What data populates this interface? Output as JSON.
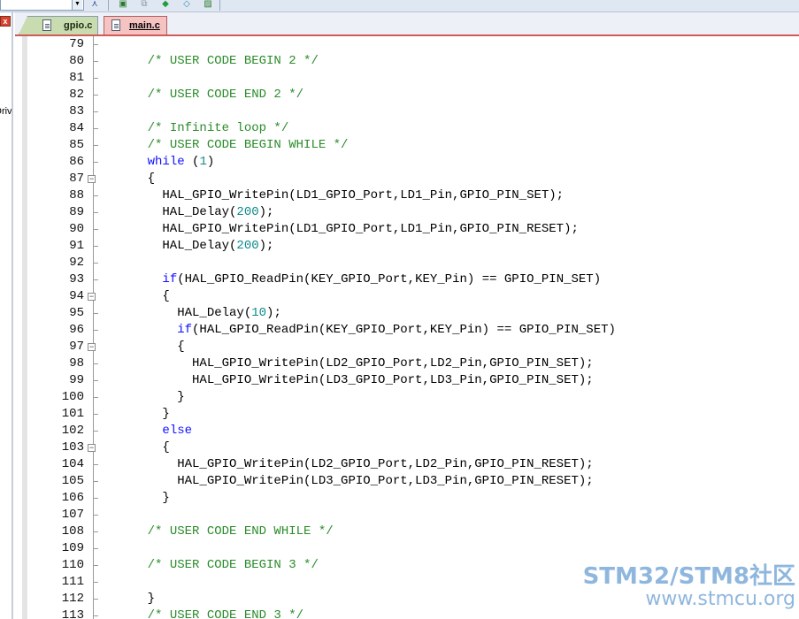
{
  "toolbar": {
    "dropdown_value": "",
    "buttons": [
      "tree-icon",
      "window-icon",
      "copy-icon",
      "green-diamond-icon",
      "brush-icon",
      "image-icon"
    ]
  },
  "project_panel": {
    "close_label": "x",
    "partial_text": "Driv"
  },
  "tabs": [
    {
      "label": "gpio.c",
      "active": false
    },
    {
      "label": "main.c",
      "active": true
    }
  ],
  "editor": {
    "lines": [
      {
        "n": "79",
        "fold": "",
        "parts": []
      },
      {
        "n": "80",
        "fold": "",
        "parts": [
          {
            "t": "    "
          },
          {
            "t": "/* USER CODE BEGIN 2 */",
            "c": "cmt"
          }
        ]
      },
      {
        "n": "81",
        "fold": "",
        "parts": []
      },
      {
        "n": "82",
        "fold": "",
        "parts": [
          {
            "t": "    "
          },
          {
            "t": "/* USER CODE END 2 */",
            "c": "cmt"
          }
        ]
      },
      {
        "n": "83",
        "fold": "",
        "parts": []
      },
      {
        "n": "84",
        "fold": "",
        "parts": [
          {
            "t": "    "
          },
          {
            "t": "/* Infinite loop */",
            "c": "cmt"
          }
        ]
      },
      {
        "n": "85",
        "fold": "",
        "parts": [
          {
            "t": "    "
          },
          {
            "t": "/* USER CODE BEGIN WHILE */",
            "c": "cmt"
          }
        ]
      },
      {
        "n": "86",
        "fold": "",
        "parts": [
          {
            "t": "    "
          },
          {
            "t": "while",
            "c": "kw"
          },
          {
            "t": " ("
          },
          {
            "t": "1",
            "c": "num"
          },
          {
            "t": ")"
          }
        ]
      },
      {
        "n": "87",
        "fold": "minus",
        "parts": [
          {
            "t": "    {"
          }
        ]
      },
      {
        "n": "88",
        "fold": "",
        "parts": [
          {
            "t": "      HAL_GPIO_WritePin(LD1_GPIO_Port,LD1_Pin,GPIO_PIN_SET);"
          }
        ]
      },
      {
        "n": "89",
        "fold": "",
        "parts": [
          {
            "t": "      HAL_Delay("
          },
          {
            "t": "200",
            "c": "num"
          },
          {
            "t": ");"
          }
        ]
      },
      {
        "n": "90",
        "fold": "",
        "parts": [
          {
            "t": "      HAL_GPIO_WritePin(LD1_GPIO_Port,LD1_Pin,GPIO_PIN_RESET);"
          }
        ]
      },
      {
        "n": "91",
        "fold": "",
        "parts": [
          {
            "t": "      HAL_Delay("
          },
          {
            "t": "200",
            "c": "num"
          },
          {
            "t": ");"
          }
        ]
      },
      {
        "n": "92",
        "fold": "",
        "parts": []
      },
      {
        "n": "93",
        "fold": "",
        "parts": [
          {
            "t": "      "
          },
          {
            "t": "if",
            "c": "kw"
          },
          {
            "t": "(HAL_GPIO_ReadPin(KEY_GPIO_Port,KEY_Pin) == GPIO_PIN_SET)"
          }
        ]
      },
      {
        "n": "94",
        "fold": "minus",
        "parts": [
          {
            "t": "      {"
          }
        ]
      },
      {
        "n": "95",
        "fold": "",
        "parts": [
          {
            "t": "        HAL_Delay("
          },
          {
            "t": "10",
            "c": "num"
          },
          {
            "t": ");"
          }
        ]
      },
      {
        "n": "96",
        "fold": "",
        "parts": [
          {
            "t": "        "
          },
          {
            "t": "if",
            "c": "kw"
          },
          {
            "t": "(HAL_GPIO_ReadPin(KEY_GPIO_Port,KEY_Pin) == GPIO_PIN_SET)"
          }
        ]
      },
      {
        "n": "97",
        "fold": "minus",
        "parts": [
          {
            "t": "        {"
          }
        ]
      },
      {
        "n": "98",
        "fold": "",
        "parts": [
          {
            "t": "          HAL_GPIO_WritePin(LD2_GPIO_Port,LD2_Pin,GPIO_PIN_SET);"
          }
        ]
      },
      {
        "n": "99",
        "fold": "",
        "parts": [
          {
            "t": "          HAL_GPIO_WritePin(LD3_GPIO_Port,LD3_Pin,GPIO_PIN_SET);"
          }
        ]
      },
      {
        "n": "100",
        "fold": "",
        "parts": [
          {
            "t": "        }"
          }
        ]
      },
      {
        "n": "101",
        "fold": "",
        "parts": [
          {
            "t": "      }"
          }
        ]
      },
      {
        "n": "102",
        "fold": "",
        "parts": [
          {
            "t": "      "
          },
          {
            "t": "else",
            "c": "kw"
          }
        ]
      },
      {
        "n": "103",
        "fold": "minus",
        "parts": [
          {
            "t": "      {"
          }
        ]
      },
      {
        "n": "104",
        "fold": "",
        "parts": [
          {
            "t": "        HAL_GPIO_WritePin(LD2_GPIO_Port,LD2_Pin,GPIO_PIN_RESET);"
          }
        ]
      },
      {
        "n": "105",
        "fold": "",
        "parts": [
          {
            "t": "        HAL_GPIO_WritePin(LD3_GPIO_Port,LD3_Pin,GPIO_PIN_RESET);"
          }
        ]
      },
      {
        "n": "106",
        "fold": "",
        "parts": [
          {
            "t": "      }"
          }
        ]
      },
      {
        "n": "107",
        "fold": "",
        "parts": []
      },
      {
        "n": "108",
        "fold": "",
        "parts": [
          {
            "t": "    "
          },
          {
            "t": "/* USER CODE END WHILE */",
            "c": "cmt"
          }
        ]
      },
      {
        "n": "109",
        "fold": "",
        "parts": []
      },
      {
        "n": "110",
        "fold": "",
        "parts": [
          {
            "t": "    "
          },
          {
            "t": "/* USER CODE BEGIN 3 */",
            "c": "cmt"
          }
        ]
      },
      {
        "n": "111",
        "fold": "",
        "parts": []
      },
      {
        "n": "112",
        "fold": "",
        "parts": [
          {
            "t": "    }"
          }
        ]
      },
      {
        "n": "113",
        "fold": "",
        "parts": [
          {
            "t": "    "
          },
          {
            "t": "/* USER CODE END 3 */",
            "c": "cmt"
          }
        ]
      }
    ]
  },
  "watermark": {
    "line1": "STM32/STM8社区",
    "line2": "www.stmcu.org"
  },
  "colors": {
    "comment": "#2a8c2a",
    "keyword": "#1010ff",
    "number": "#0d8a8a",
    "active_tab": "#f6c3c3",
    "inactive_tab": "#c9dcaf"
  }
}
